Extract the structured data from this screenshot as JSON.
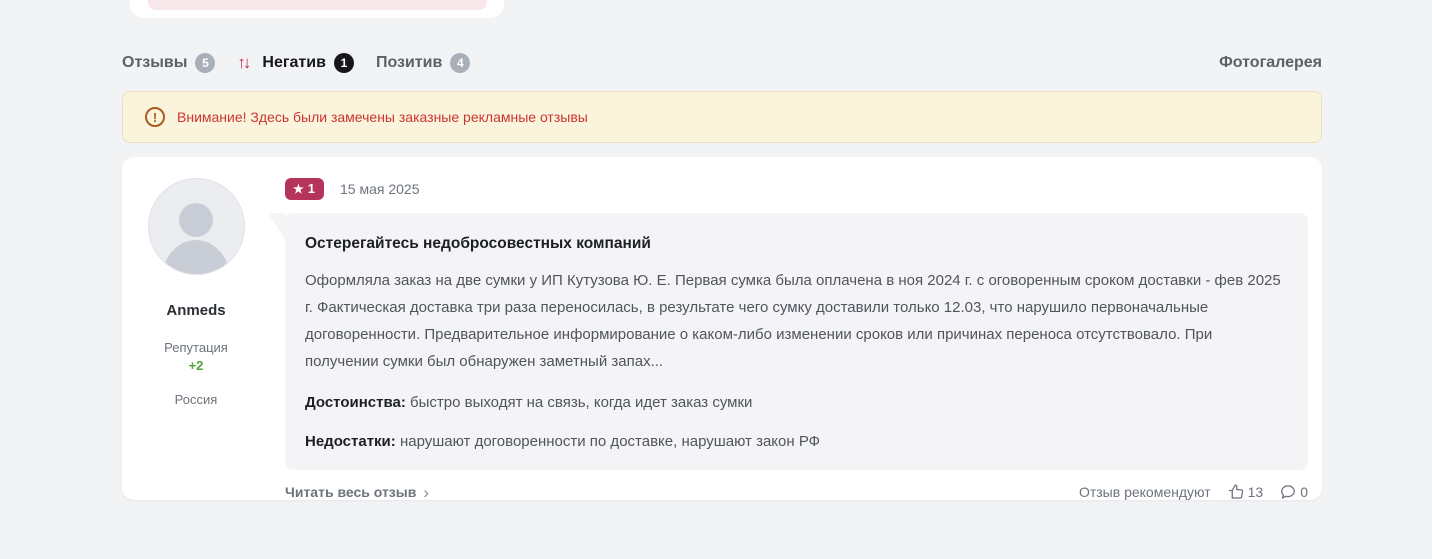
{
  "tabs": {
    "reviews": {
      "label": "Отзывы",
      "count": "5"
    },
    "negative": {
      "label": "Негатив",
      "count": "1"
    },
    "positive": {
      "label": "Позитив",
      "count": "4"
    },
    "photogallery": {
      "label": "Фотогалерея"
    }
  },
  "icons": {
    "sort_up": "↑",
    "sort_down": "↓",
    "warning": "!",
    "star": "★",
    "read_more_chevron": "›"
  },
  "warning": {
    "text": "Внимание! Здесь были замечены заказные рекламные отзывы"
  },
  "review": {
    "rating": "1",
    "date": "15 мая 2025",
    "author": {
      "name": "Anmeds",
      "reputation_label": "Репутация",
      "reputation_value": "+2",
      "location": "Россия"
    },
    "title": "Остерегайтесь недобросовестных компаний",
    "body": "Оформляла заказ на две сумки у ИП Кутузова Ю. Е. Первая сумка была оплачена в ноя 2024 г. с оговоренным сроком доставки - фев 2025 г. Фактическая доставка три раза переносилась, в результате чего сумку доставили только 12.03, что нарушило первоначальные договоренности. Предварительное информирование о каком-либо изменении сроков или причинах переноса отсутствовало. При получении сумки был обнаружен заметный запах...",
    "pros_label": "Достоинства:",
    "pros": "быстро выходят на связь, когда идет заказ сумки",
    "cons_label": "Недостатки:",
    "cons": "нарушают договоренности по доставке, нарушают закон РФ",
    "read_more": "Читать весь отзыв",
    "recommend_label": "Отзыв рекомендуют",
    "likes": "13",
    "comments": "0"
  },
  "colors": {
    "accent_crimson": "#b5345a",
    "warning_text": "#cd3530",
    "warning_bg": "#fbf4dd",
    "reputation_green": "#54a23c",
    "page_bg": "#f2f3f5"
  }
}
